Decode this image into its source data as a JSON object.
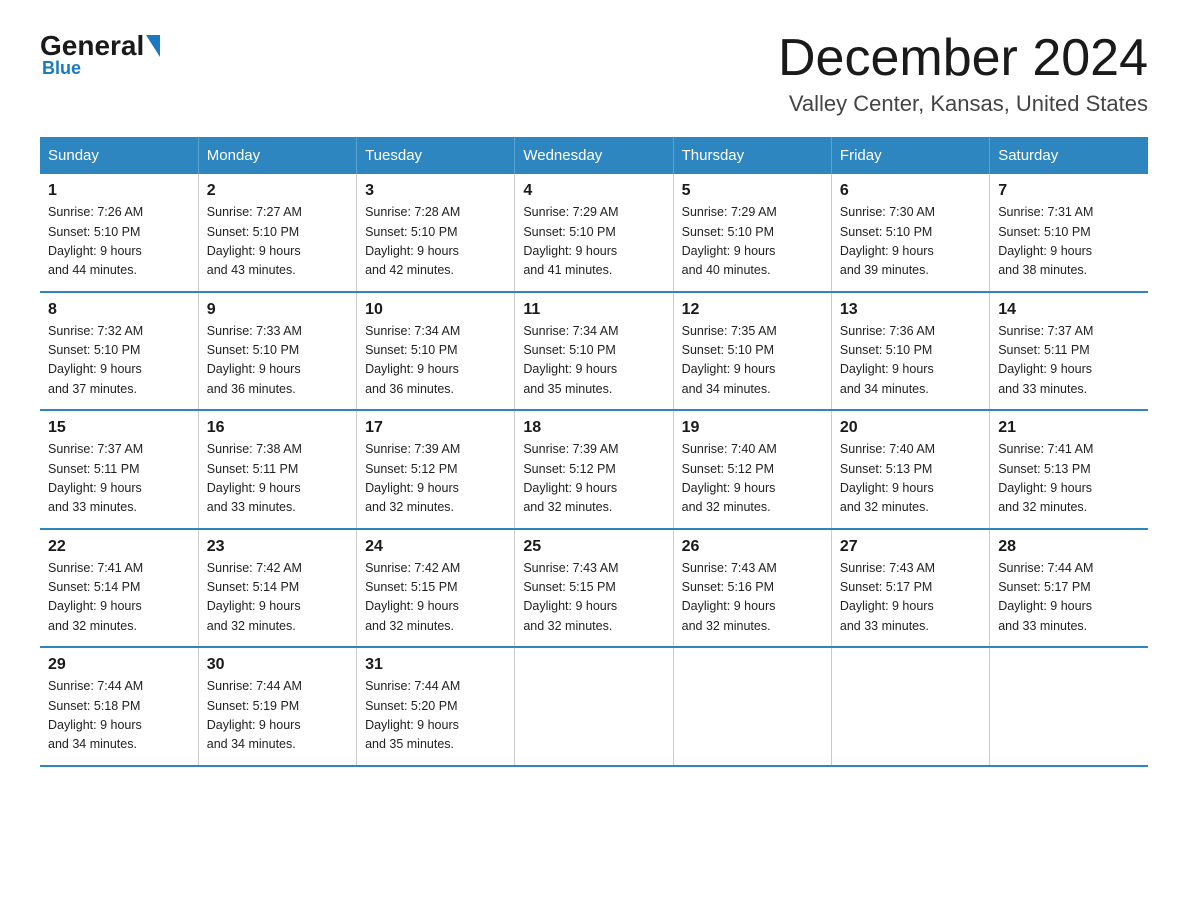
{
  "logo": {
    "general": "General",
    "blue": "Blue",
    "underline": "Blue"
  },
  "title": "December 2024",
  "subtitle": "Valley Center, Kansas, United States",
  "days_of_week": [
    "Sunday",
    "Monday",
    "Tuesday",
    "Wednesday",
    "Thursday",
    "Friday",
    "Saturday"
  ],
  "weeks": [
    [
      {
        "day": "1",
        "sunrise": "7:26 AM",
        "sunset": "5:10 PM",
        "daylight": "9 hours and 44 minutes."
      },
      {
        "day": "2",
        "sunrise": "7:27 AM",
        "sunset": "5:10 PM",
        "daylight": "9 hours and 43 minutes."
      },
      {
        "day": "3",
        "sunrise": "7:28 AM",
        "sunset": "5:10 PM",
        "daylight": "9 hours and 42 minutes."
      },
      {
        "day": "4",
        "sunrise": "7:29 AM",
        "sunset": "5:10 PM",
        "daylight": "9 hours and 41 minutes."
      },
      {
        "day": "5",
        "sunrise": "7:29 AM",
        "sunset": "5:10 PM",
        "daylight": "9 hours and 40 minutes."
      },
      {
        "day": "6",
        "sunrise": "7:30 AM",
        "sunset": "5:10 PM",
        "daylight": "9 hours and 39 minutes."
      },
      {
        "day": "7",
        "sunrise": "7:31 AM",
        "sunset": "5:10 PM",
        "daylight": "9 hours and 38 minutes."
      }
    ],
    [
      {
        "day": "8",
        "sunrise": "7:32 AM",
        "sunset": "5:10 PM",
        "daylight": "9 hours and 37 minutes."
      },
      {
        "day": "9",
        "sunrise": "7:33 AM",
        "sunset": "5:10 PM",
        "daylight": "9 hours and 36 minutes."
      },
      {
        "day": "10",
        "sunrise": "7:34 AM",
        "sunset": "5:10 PM",
        "daylight": "9 hours and 36 minutes."
      },
      {
        "day": "11",
        "sunrise": "7:34 AM",
        "sunset": "5:10 PM",
        "daylight": "9 hours and 35 minutes."
      },
      {
        "day": "12",
        "sunrise": "7:35 AM",
        "sunset": "5:10 PM",
        "daylight": "9 hours and 34 minutes."
      },
      {
        "day": "13",
        "sunrise": "7:36 AM",
        "sunset": "5:10 PM",
        "daylight": "9 hours and 34 minutes."
      },
      {
        "day": "14",
        "sunrise": "7:37 AM",
        "sunset": "5:11 PM",
        "daylight": "9 hours and 33 minutes."
      }
    ],
    [
      {
        "day": "15",
        "sunrise": "7:37 AM",
        "sunset": "5:11 PM",
        "daylight": "9 hours and 33 minutes."
      },
      {
        "day": "16",
        "sunrise": "7:38 AM",
        "sunset": "5:11 PM",
        "daylight": "9 hours and 33 minutes."
      },
      {
        "day": "17",
        "sunrise": "7:39 AM",
        "sunset": "5:12 PM",
        "daylight": "9 hours and 32 minutes."
      },
      {
        "day": "18",
        "sunrise": "7:39 AM",
        "sunset": "5:12 PM",
        "daylight": "9 hours and 32 minutes."
      },
      {
        "day": "19",
        "sunrise": "7:40 AM",
        "sunset": "5:12 PM",
        "daylight": "9 hours and 32 minutes."
      },
      {
        "day": "20",
        "sunrise": "7:40 AM",
        "sunset": "5:13 PM",
        "daylight": "9 hours and 32 minutes."
      },
      {
        "day": "21",
        "sunrise": "7:41 AM",
        "sunset": "5:13 PM",
        "daylight": "9 hours and 32 minutes."
      }
    ],
    [
      {
        "day": "22",
        "sunrise": "7:41 AM",
        "sunset": "5:14 PM",
        "daylight": "9 hours and 32 minutes."
      },
      {
        "day": "23",
        "sunrise": "7:42 AM",
        "sunset": "5:14 PM",
        "daylight": "9 hours and 32 minutes."
      },
      {
        "day": "24",
        "sunrise": "7:42 AM",
        "sunset": "5:15 PM",
        "daylight": "9 hours and 32 minutes."
      },
      {
        "day": "25",
        "sunrise": "7:43 AM",
        "sunset": "5:15 PM",
        "daylight": "9 hours and 32 minutes."
      },
      {
        "day": "26",
        "sunrise": "7:43 AM",
        "sunset": "5:16 PM",
        "daylight": "9 hours and 32 minutes."
      },
      {
        "day": "27",
        "sunrise": "7:43 AM",
        "sunset": "5:17 PM",
        "daylight": "9 hours and 33 minutes."
      },
      {
        "day": "28",
        "sunrise": "7:44 AM",
        "sunset": "5:17 PM",
        "daylight": "9 hours and 33 minutes."
      }
    ],
    [
      {
        "day": "29",
        "sunrise": "7:44 AM",
        "sunset": "5:18 PM",
        "daylight": "9 hours and 34 minutes."
      },
      {
        "day": "30",
        "sunrise": "7:44 AM",
        "sunset": "5:19 PM",
        "daylight": "9 hours and 34 minutes."
      },
      {
        "day": "31",
        "sunrise": "7:44 AM",
        "sunset": "5:20 PM",
        "daylight": "9 hours and 35 minutes."
      },
      null,
      null,
      null,
      null
    ]
  ],
  "labels": {
    "sunrise": "Sunrise:",
    "sunset": "Sunset:",
    "daylight": "Daylight:"
  }
}
